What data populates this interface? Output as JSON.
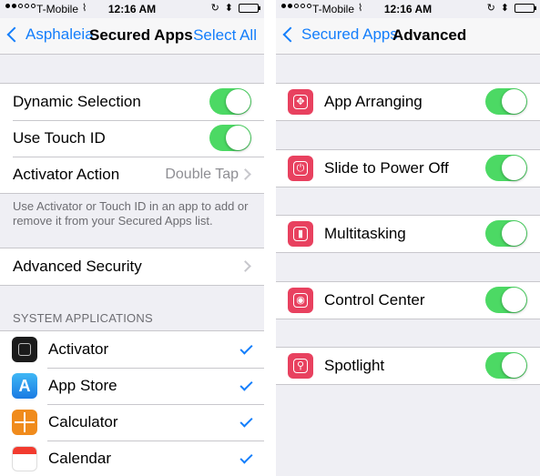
{
  "left": {
    "status": {
      "carrier": "T-Mobile",
      "time": "12:16 AM"
    },
    "nav": {
      "back": "Asphaleia",
      "title": "Secured Apps",
      "right": "Select All"
    },
    "settings": [
      {
        "label": "Dynamic Selection",
        "toggle": true
      },
      {
        "label": "Use Touch ID",
        "toggle": true
      },
      {
        "label": "Activator Action",
        "value": "Double Tap"
      }
    ],
    "settings_footer": "Use Activator or Touch ID in an app to add or remove it from your Secured Apps list.",
    "advanced": {
      "label": "Advanced Security"
    },
    "section_header": "SYSTEM APPLICATIONS",
    "apps": [
      {
        "label": "Activator",
        "checked": true
      },
      {
        "label": "App Store",
        "checked": true
      },
      {
        "label": "Calculator",
        "checked": true
      },
      {
        "label": "Calendar",
        "checked": true
      }
    ]
  },
  "right": {
    "status": {
      "carrier": "T-Mobile",
      "time": "12:16 AM"
    },
    "nav": {
      "back": "Secured Apps",
      "title": "Advanced"
    },
    "items": [
      {
        "label": "App Arranging",
        "icon": "arrange-icon",
        "toggle": true
      },
      {
        "label": "Slide to Power Off",
        "icon": "power-icon",
        "toggle": true
      },
      {
        "label": "Multitasking",
        "icon": "multitasking-icon",
        "toggle": true
      },
      {
        "label": "Control Center",
        "icon": "control-center-icon",
        "toggle": true
      },
      {
        "label": "Spotlight",
        "icon": "spotlight-icon",
        "toggle": true
      }
    ]
  },
  "colors": {
    "accent": "#147efb",
    "toggle_on": "#4cd964",
    "feature_icon": "#e8415f",
    "group_bg": "#efeff4"
  }
}
